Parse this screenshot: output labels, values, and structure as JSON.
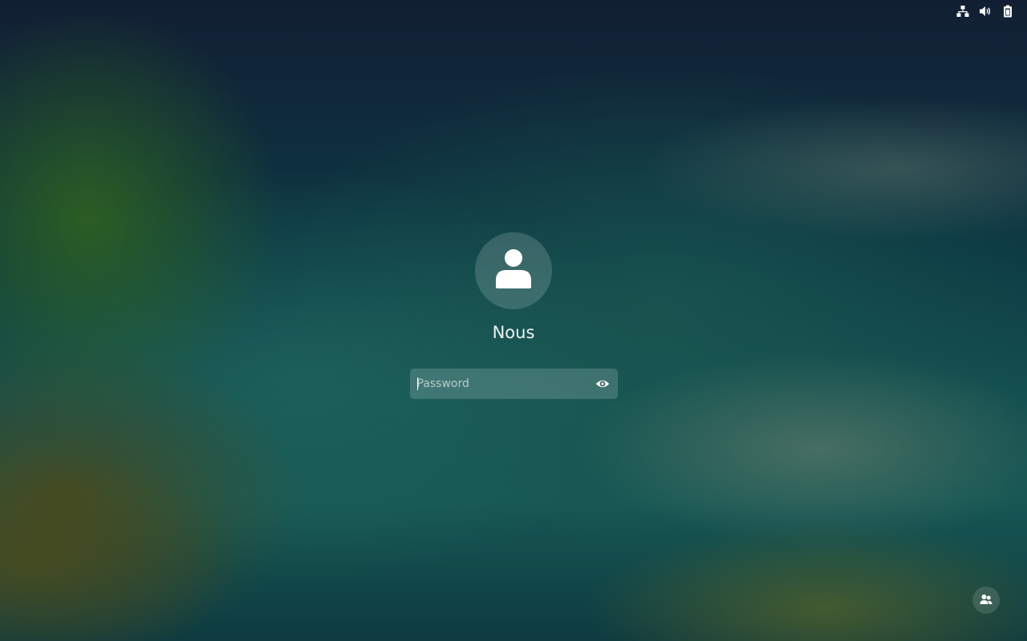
{
  "top_bar": {
    "icons": [
      "network-wired-icon",
      "volume-icon",
      "battery-icon"
    ]
  },
  "login": {
    "avatar_icon": "user-avatar-icon",
    "user_name": "Nous",
    "password": {
      "value": "",
      "placeholder": "Password",
      "reveal_icon": "eye-icon"
    }
  },
  "bottom": {
    "switch_user_icon": "switch-user-icon"
  },
  "colors": {
    "text": "#eef2f1",
    "field_background": "rgba(255,255,255,0.17)"
  }
}
